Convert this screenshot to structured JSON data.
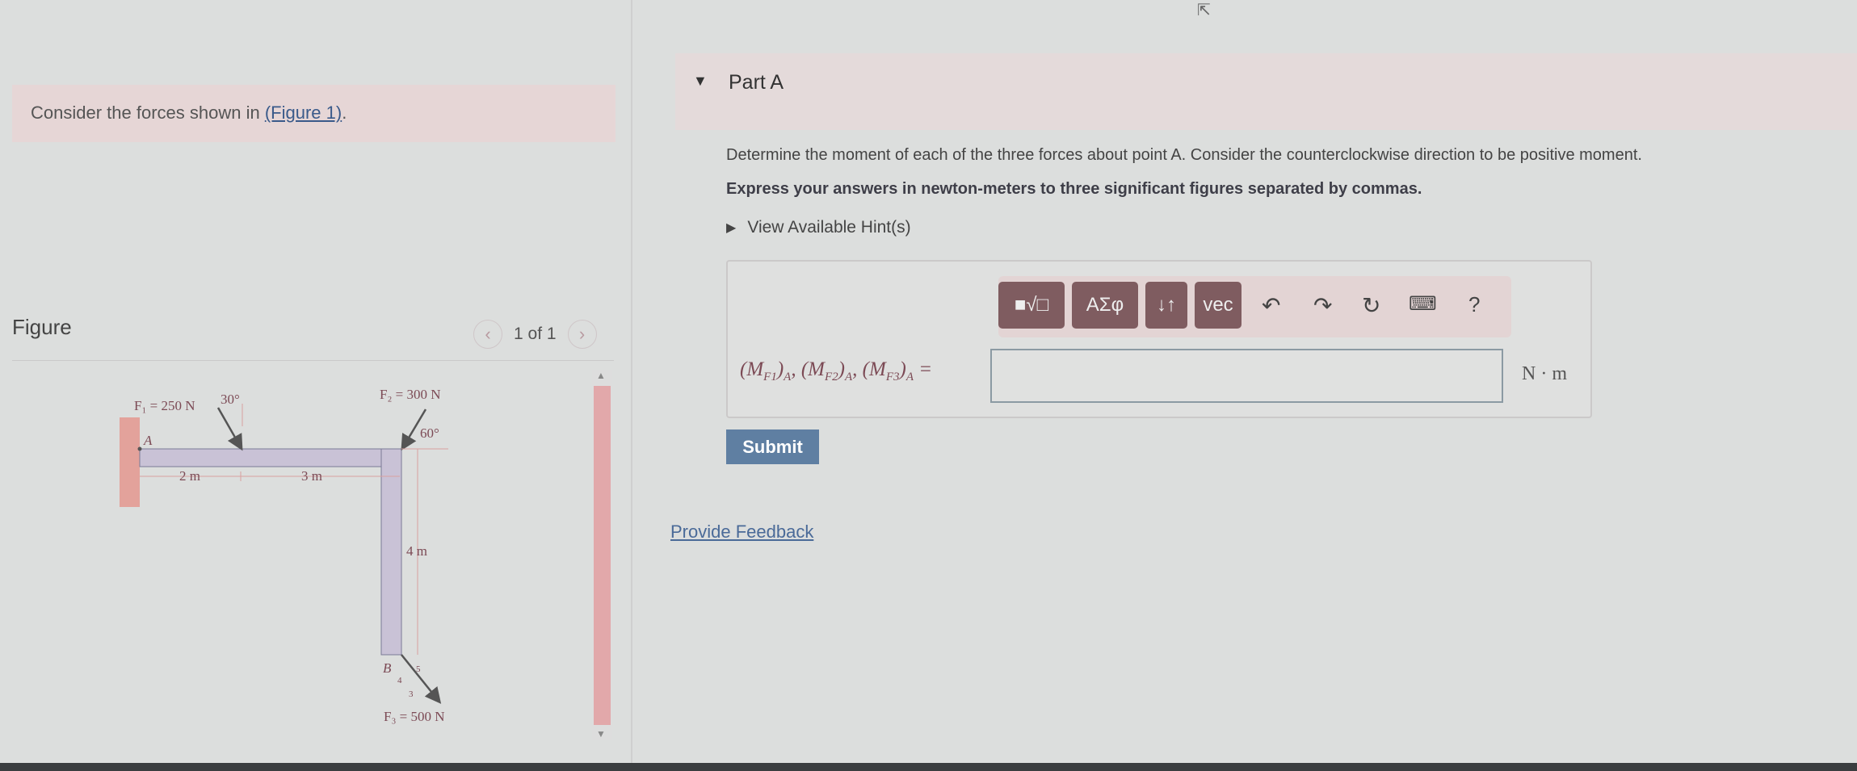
{
  "intro": {
    "prefix": "Consider the forces shown in ",
    "link": "(Figure 1)",
    "suffix": "."
  },
  "figure_panel": {
    "title": "Figure",
    "pager": "1 of 1",
    "prev_icon": "chevron-left-icon",
    "next_icon": "chevron-right-icon"
  },
  "figure": {
    "f1_label": "F₁ = 250 N",
    "f1_angle": "30°",
    "f2_label": "F₂ = 300 N",
    "f2_angle": "60°",
    "f3_label": "F₃ = 500 N",
    "point_a": "A",
    "point_b": "B",
    "dim1": "2 m",
    "dim2": "3 m",
    "dim3": "4 m",
    "slope_hyp": "5",
    "slope_v": "4",
    "slope_h": "3"
  },
  "part": {
    "title": "Part A"
  },
  "question": {
    "text": "Determine the moment of each of the three forces about point A. Consider the counterclockwise direction to be positive moment.",
    "instruction": "Express your answers in newton-meters to three significant figures separated by commas.",
    "hint": "View Available Hint(s)"
  },
  "toolbar": {
    "templates": "■√□",
    "greek": "ΑΣφ",
    "arrows": "↓↑",
    "vec": "vec",
    "help": "?"
  },
  "answer": {
    "label_parts": [
      "M",
      "F1",
      "A",
      "M",
      "F2",
      "A",
      "M",
      "F3",
      "A"
    ],
    "value": "",
    "units": "N · m"
  },
  "actions": {
    "submit": "Submit",
    "feedback": "Provide Feedback"
  },
  "colors": {
    "submit": "#5f7fa2",
    "toolbar_button": "#7f5c60",
    "link": "#4a6a98"
  }
}
